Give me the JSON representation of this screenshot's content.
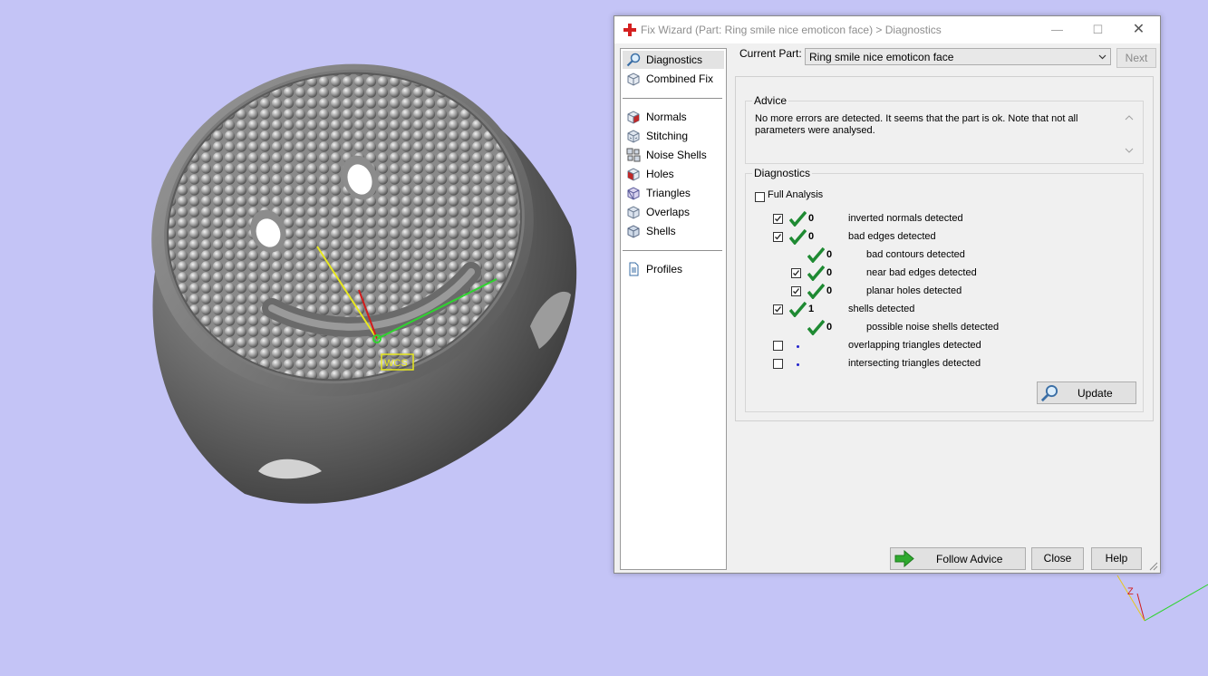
{
  "viewport": {
    "wcs_label": "WCS",
    "axis_z_label": "Z",
    "background_color": "#c4c4f6"
  },
  "dialog": {
    "title": "Fix Wizard (Part: Ring smile nice emoticon face) > Diagnostics",
    "nav": {
      "items": [
        {
          "label": "Diagnostics",
          "icon": "magnifier-icon",
          "selected": true
        },
        {
          "label": "Combined Fix",
          "icon": "cube-icon"
        },
        {
          "label": "Normals",
          "icon": "normals-cube-icon"
        },
        {
          "label": "Stitching",
          "icon": "stitching-cube-icon"
        },
        {
          "label": "Noise Shells",
          "icon": "noise-shells-icon"
        },
        {
          "label": "Holes",
          "icon": "holes-cube-icon"
        },
        {
          "label": "Triangles",
          "icon": "triangles-cube-icon"
        },
        {
          "label": "Overlaps",
          "icon": "overlaps-cube-icon"
        },
        {
          "label": "Shells",
          "icon": "shells-cube-icon"
        },
        {
          "label": "Profiles",
          "icon": "document-icon"
        }
      ]
    },
    "current_part": {
      "label": "Current Part:",
      "value": "Ring smile nice emoticon face"
    },
    "next_label": "Next",
    "advice": {
      "title": "Advice",
      "text": "No more errors are detected. It seems that the part is ok. Note that not all parameters were analysed."
    },
    "diagnostics": {
      "title": "Diagnostics",
      "full_analysis_label": "Full Analysis",
      "full_analysis_checked": false,
      "rows": [
        {
          "checkbox": true,
          "checked": true,
          "status": "ok",
          "count": "0",
          "label": "inverted normals detected",
          "level": 0
        },
        {
          "checkbox": true,
          "checked": true,
          "status": "ok",
          "count": "0",
          "label": "bad edges detected",
          "level": 0
        },
        {
          "checkbox": false,
          "checked": false,
          "status": "ok",
          "count": "0",
          "label": "bad contours detected",
          "level": 1
        },
        {
          "checkbox": true,
          "checked": true,
          "status": "ok",
          "count": "0",
          "label": "near bad edges detected",
          "level": 1
        },
        {
          "checkbox": true,
          "checked": true,
          "status": "ok",
          "count": "0",
          "label": "planar holes detected",
          "level": 1
        },
        {
          "checkbox": true,
          "checked": true,
          "status": "ok",
          "count": "1",
          "label": "shells detected",
          "level": 0
        },
        {
          "checkbox": false,
          "checked": false,
          "status": "ok",
          "count": "0",
          "label": "possible noise shells detected",
          "level": 1
        },
        {
          "checkbox": true,
          "checked": false,
          "status": "pending",
          "count": "",
          "label": "overlapping triangles detected",
          "level": 0
        },
        {
          "checkbox": true,
          "checked": false,
          "status": "pending",
          "count": "",
          "label": "intersecting triangles detected",
          "level": 0
        }
      ],
      "update_label": "Update"
    },
    "buttons": {
      "follow_advice": "Follow Advice",
      "close": "Close",
      "help": "Help"
    },
    "colors": {
      "ok_tick": "#1e8a32",
      "pending_dot": "#2222cc",
      "follow_arrow": "#2faa2f"
    }
  }
}
